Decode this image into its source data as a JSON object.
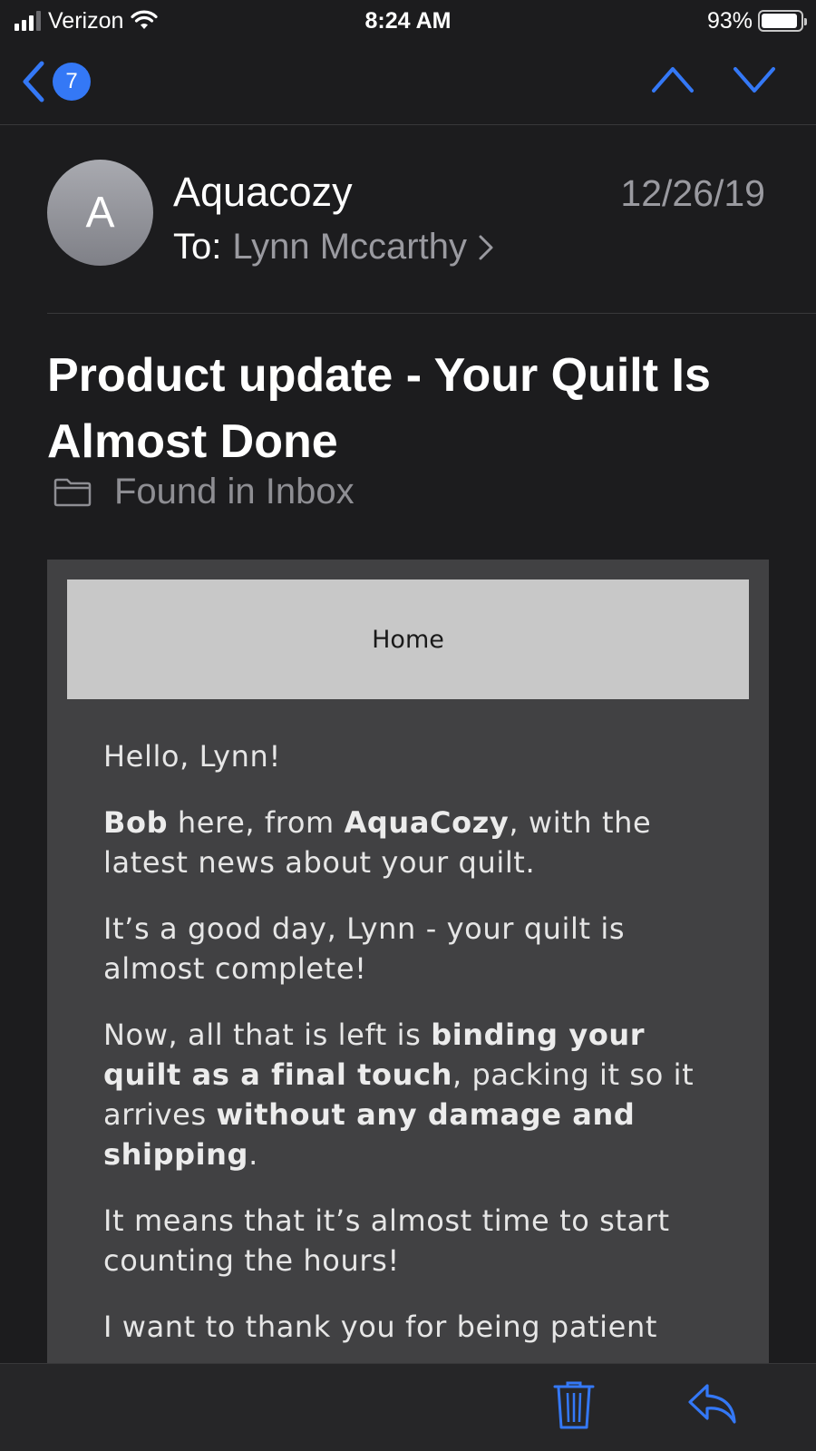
{
  "status_bar": {
    "carrier": "Verizon",
    "time": "8:24 AM",
    "battery_percent": "93%",
    "battery_level": 0.93,
    "signal_bars": 3
  },
  "nav": {
    "unread_count": "7",
    "accent_color": "#3478f6"
  },
  "message": {
    "sender_initial": "A",
    "sender": "Aquacozy",
    "date": "12/26/19",
    "to_label": "To:",
    "to_name": "Lynn Mccarthy",
    "subject": "Product update - Your Quilt Is Almost Done",
    "folder_text": "Found in Inbox"
  },
  "email_body": {
    "home_label": "Home",
    "greeting": "Hello, Lynn!",
    "p1": {
      "b1": "Bob",
      "t1": " here, from ",
      "b2": "AquaCozy",
      "t2": ", with the latest news about your quilt."
    },
    "p2": "It’s a good day, Lynn - your quilt is almost complete!",
    "p3": {
      "t1": "Now, all that is left is ",
      "b1": "binding your quilt as a final touch",
      "t2": ", packing it so it arrives ",
      "b2": "without any damage and shipping",
      "t3": "."
    },
    "p4": "It means that it’s almost time to start counting the hours!",
    "p5": "I want to thank you for being patient"
  },
  "toolbar": {
    "icons": [
      "trash-icon",
      "reply-icon"
    ]
  }
}
